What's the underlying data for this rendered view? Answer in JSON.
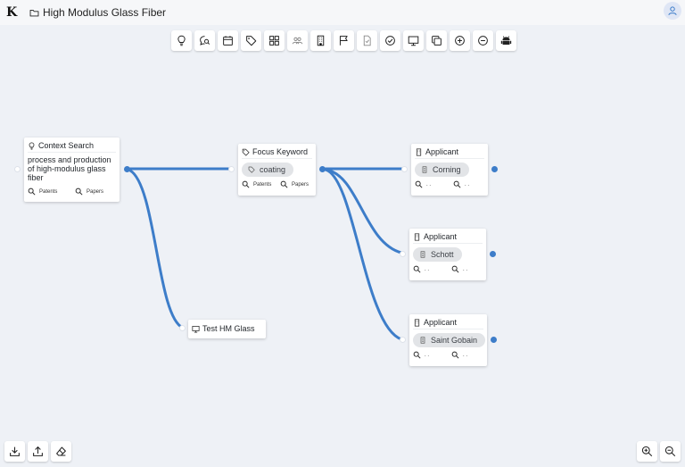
{
  "header": {
    "logo": "K",
    "project_title": "High Modulus Glass Fiber"
  },
  "toolbar": {
    "tools": [
      "lightbulb-icon",
      "chat-search-icon",
      "calendar-icon",
      "tag-icon",
      "grid-icon",
      "people-icon",
      "building-icon",
      "flag-icon",
      "document-icon",
      "check-circle-icon",
      "monitor-icon",
      "copy-icon",
      "plus-circle-icon",
      "minus-circle-icon",
      "android-icon"
    ]
  },
  "nodes": {
    "context": {
      "title": "Context Search",
      "text": "process and production of high-modulus glass fiber",
      "patents_label": "Patents",
      "papers_label": "Papers"
    },
    "focus": {
      "title": "Focus Keyword",
      "chip": "coating",
      "patents_label": "Patents",
      "papers_label": "Papers"
    },
    "test": {
      "title": "Test HM Glass"
    },
    "applicants": [
      {
        "title": "Applicant",
        "chip": "Corning",
        "dots1": ". .",
        "dots2": ". ."
      },
      {
        "title": "Applicant",
        "chip": "Schott",
        "dots1": ". .",
        "dots2": ". ."
      },
      {
        "title": "Applicant",
        "chip": "Saint Gobain",
        "dots1": ". .",
        "dots2": ". ."
      }
    ]
  },
  "colors": {
    "edge": "#3d7dc9",
    "canvas": "#eef1f6"
  }
}
